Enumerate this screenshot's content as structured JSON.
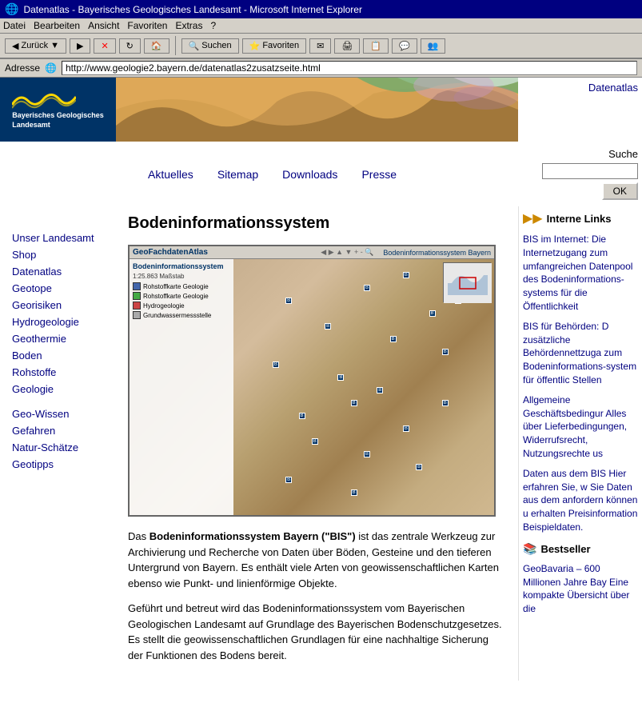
{
  "titlebar": {
    "text": "Datenatlas - Bayerisches Geologisches Landesamt - Microsoft Internet Explorer",
    "icon": "🌐"
  },
  "menubar": {
    "items": [
      "Datei",
      "Bearbeiten",
      "Ansicht",
      "Favoriten",
      "Extras",
      "?"
    ]
  },
  "toolbar": {
    "back_label": "Zurück",
    "search_label": "Suchen",
    "favorites_label": "Favoriten"
  },
  "addressbar": {
    "label": "Adresse",
    "url": "http://www.geologie2.bayern.de/datenatlas2zusatzseite.html"
  },
  "header": {
    "logo_line1": "Bayerisches Geologisches",
    "logo_line2": "Landesamt",
    "datenatlas_link": "Datenatlas",
    "search_label": "Suche",
    "search_placeholder": "",
    "search_button": "OK"
  },
  "topnav": {
    "items": [
      "Aktuelles",
      "Sitemap",
      "Downloads",
      "Presse"
    ]
  },
  "sidebar": {
    "items": [
      "Unser Landesamt",
      "Shop",
      "Datenatlas",
      "Geotope",
      "Georisiken",
      "Hydrogeologie",
      "Geothermie",
      "Boden",
      "Rohstoffe",
      "Geologie",
      "Geo-Wissen",
      "Gefahren",
      "Natur-Schätze",
      "Geotipps"
    ]
  },
  "main": {
    "page_title": "Bodeninformationssystem",
    "map_title": "GeoFachdatenAtlas",
    "map_subtitle": "Bodeninformationssystem Bayern",
    "body_paragraph1": "Das Bodeninformationssystem Bayern (\"BIS\") ist das zentrale Werkzeug zur Archivierung und Recherche von Daten über Böden, Gesteine und den tieferen Untergrund von Bayern. Es enthält viele Arten von geowissenschaftlichen Karten ebenso wie Punkt- und linienförmige Objekte.",
    "body_bold": "Bodeninformationssystem Bayern (\"BIS\")",
    "body_paragraph2": "Geführt und betreut wird das Bodeninformationssystem vom Bayerischen Geologischen Landesamt auf Grundlage des Bayerischen Bodenschutzgesetzes. Es stellt die geowissenschaftlichen Grundlagen für eine nachhaltige Sicherung der Funktionen des Bodens bereit."
  },
  "right_sidebar": {
    "internal_links_title": "Interne Links",
    "links": [
      {
        "text": "BIS im Internet: Die Internetzugang zum umfangreichen Datenpool des Bodeninformations-systems für die Öffentlichkeit"
      },
      {
        "text": "BIS für Behörden: D zusätzliche Behördennettzuga zum Bodeninformations-system für öffentlic Stellen"
      },
      {
        "text": "Allgemeine Geschäftsbedingur Alles über Lieferbedingungen, Widerrufsrecht, Nutzungsrechte us"
      },
      {
        "text": "Daten aus dem BIS Hier erfahren Sie, w Sie Daten aus dem anfordern können u erhalten Preisinformation Beispieldaten."
      }
    ],
    "bestseller_title": "Bestseller",
    "bestseller_text": "GeoBavaria – 600 Millionen Jahre Bay Eine kompakte Übersicht über die"
  }
}
